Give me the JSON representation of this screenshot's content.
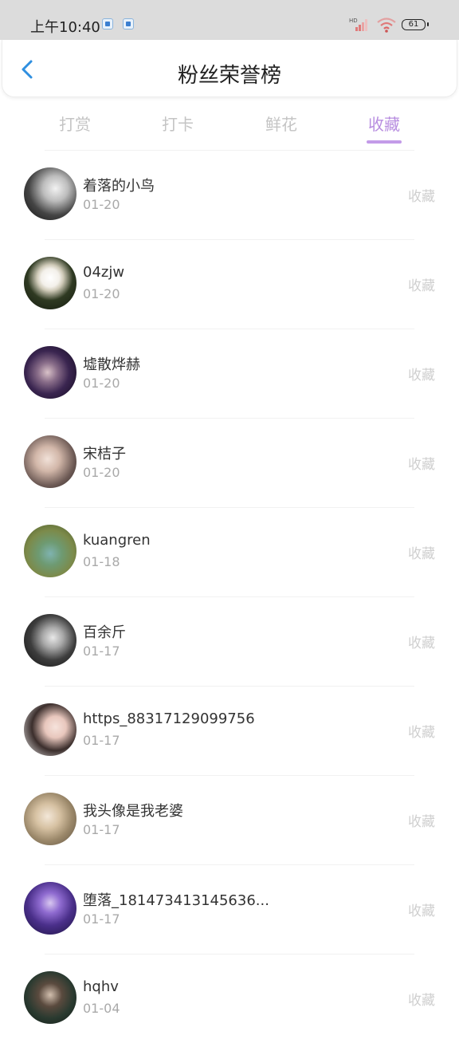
{
  "status_bar": {
    "time": "上午10:40",
    "battery": "61",
    "network_label": "HD"
  },
  "header": {
    "title": "粉丝荣誉榜"
  },
  "tabs": [
    {
      "label": "打赏",
      "active": false
    },
    {
      "label": "打卡",
      "active": false
    },
    {
      "label": "鲜花",
      "active": false
    },
    {
      "label": "收藏",
      "active": true
    }
  ],
  "colors": {
    "accent": "#b88ee0",
    "tab_inactive": "#c4c4c4",
    "back_arrow": "#2f8fe0"
  },
  "list": [
    {
      "name": "着落的小鸟",
      "date": "01-20",
      "action": "收藏"
    },
    {
      "name": "04zjw",
      "date": "01-20",
      "action": "收藏"
    },
    {
      "name": "墟散烨赫",
      "date": "01-20",
      "action": "收藏"
    },
    {
      "name": "宋桔子",
      "date": "01-20",
      "action": "收藏"
    },
    {
      "name": "kuangren",
      "date": "01-18",
      "action": "收藏"
    },
    {
      "name": "百余斤",
      "date": "01-17",
      "action": "收藏"
    },
    {
      "name": "https_88317129099756",
      "date": "01-17",
      "action": "收藏"
    },
    {
      "name": "我头像是我老婆",
      "date": "01-17",
      "action": "收藏"
    },
    {
      "name": "堕落_181473413145636...",
      "date": "01-17",
      "action": "收藏"
    },
    {
      "name": "hqhv",
      "date": "01-04",
      "action": "收藏"
    }
  ]
}
